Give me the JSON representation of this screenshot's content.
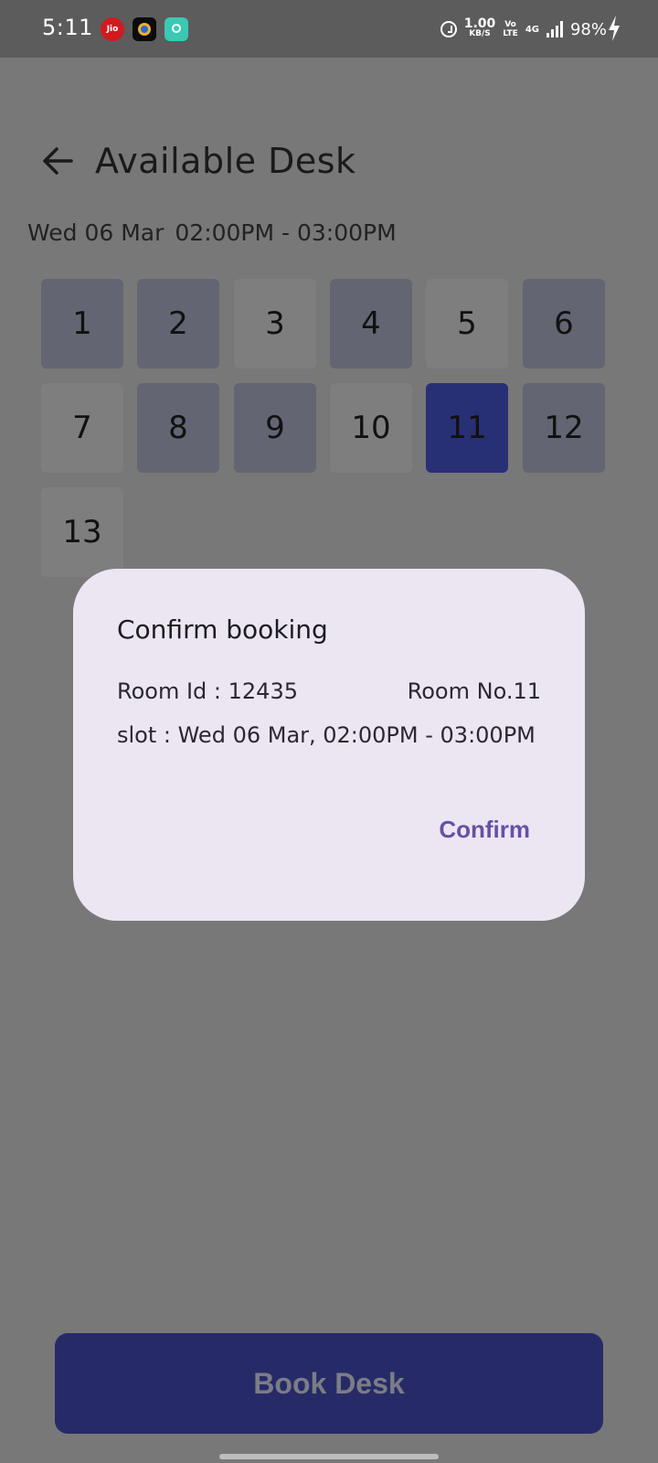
{
  "status_bar": {
    "time": "5:11",
    "jio_label": "Jio",
    "net_speed_value": "1.00",
    "net_speed_unit": "KB/S",
    "volte_top": "Vo",
    "volte_bottom": "LTE",
    "network_type": "4G",
    "battery": "98%"
  },
  "header": {
    "title": "Available Desk"
  },
  "slot": {
    "date": "Wed 06 Mar",
    "time_range": "02:00PM - 03:00PM"
  },
  "desks": [
    {
      "label": "1",
      "state": "available"
    },
    {
      "label": "2",
      "state": "available"
    },
    {
      "label": "3",
      "state": "unavailable"
    },
    {
      "label": "4",
      "state": "available"
    },
    {
      "label": "5",
      "state": "unavailable"
    },
    {
      "label": "6",
      "state": "available"
    },
    {
      "label": "7",
      "state": "unavailable"
    },
    {
      "label": "8",
      "state": "available"
    },
    {
      "label": "9",
      "state": "available"
    },
    {
      "label": "10",
      "state": "unavailable"
    },
    {
      "label": "11",
      "state": "selected"
    },
    {
      "label": "12",
      "state": "available"
    },
    {
      "label": "13",
      "state": "unavailable"
    }
  ],
  "dialog": {
    "title": "Confirm booking",
    "room_id": "Room Id : 12435",
    "room_no": "Room No.11",
    "slot": "slot : Wed 06 Mar, 02:00PM - 03:00PM",
    "confirm_label": "Confirm"
  },
  "footer": {
    "book_label": "Book Desk"
  },
  "colors": {
    "scrim": "#787878",
    "desk_available": "#636572",
    "desk_unavailable": "#7e7e7e",
    "desk_selected": "#283075",
    "dialog_bg": "#ece6f3",
    "confirm_text": "#6750a4",
    "book_button": "#262b68"
  }
}
